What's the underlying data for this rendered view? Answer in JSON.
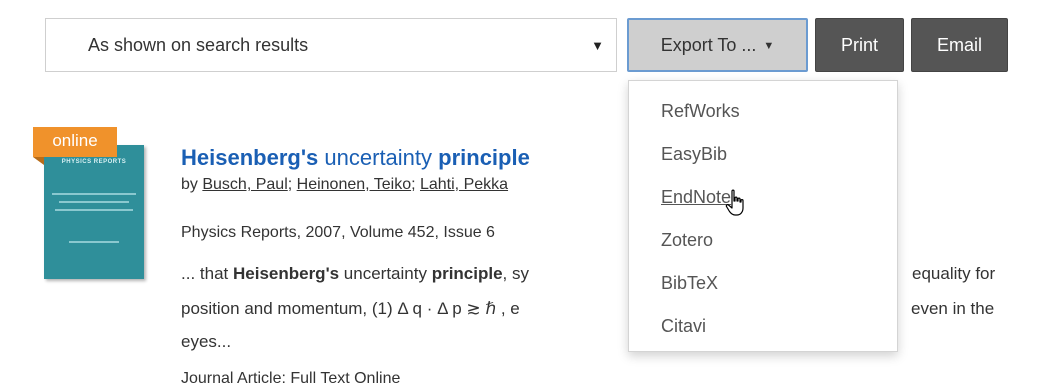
{
  "toolbar": {
    "select_value": "As shown on search results",
    "export_label": "Export To ...",
    "print_label": "Print",
    "email_label": "Email"
  },
  "export_menu": {
    "items": [
      {
        "label": "RefWorks"
      },
      {
        "label": "EasyBib"
      },
      {
        "label": "EndNote"
      },
      {
        "label": "Zotero"
      },
      {
        "label": "BibTeX"
      },
      {
        "label": "Citavi"
      }
    ],
    "hovered": "EndNote"
  },
  "result": {
    "badge": "online",
    "thumbnail_title": "PHYSICS REPORTS",
    "title_parts": {
      "p1": "Heisenberg's",
      "p2": " uncertainty ",
      "p3": "principle"
    },
    "by_label": "by",
    "authors": [
      {
        "name": "Busch, Paul"
      },
      {
        "name": "Heinonen, Teiko"
      },
      {
        "name": "Lahti, Pekka"
      }
    ],
    "source": "Physics Reports, 2007, Volume 452, Issue 6",
    "snippet": {
      "l1_a": "... that ",
      "l1_b": "Heisenberg's",
      "l1_c": " uncertainty ",
      "l1_d": "principle",
      "l1_e": ", sy",
      "l1_f": "equality for",
      "l2_a": "position and momentum, (1) Δ q · Δ p ≳ ℏ , e",
      "l2_b": "even in the",
      "l3": "eyes..."
    },
    "type": "Journal Article: Full Text Online"
  },
  "colors": {
    "title_blue": "#1a5fb4",
    "badge_orange": "#f0922b",
    "dark_button": "#555555",
    "export_button": "#cfcfcf"
  }
}
